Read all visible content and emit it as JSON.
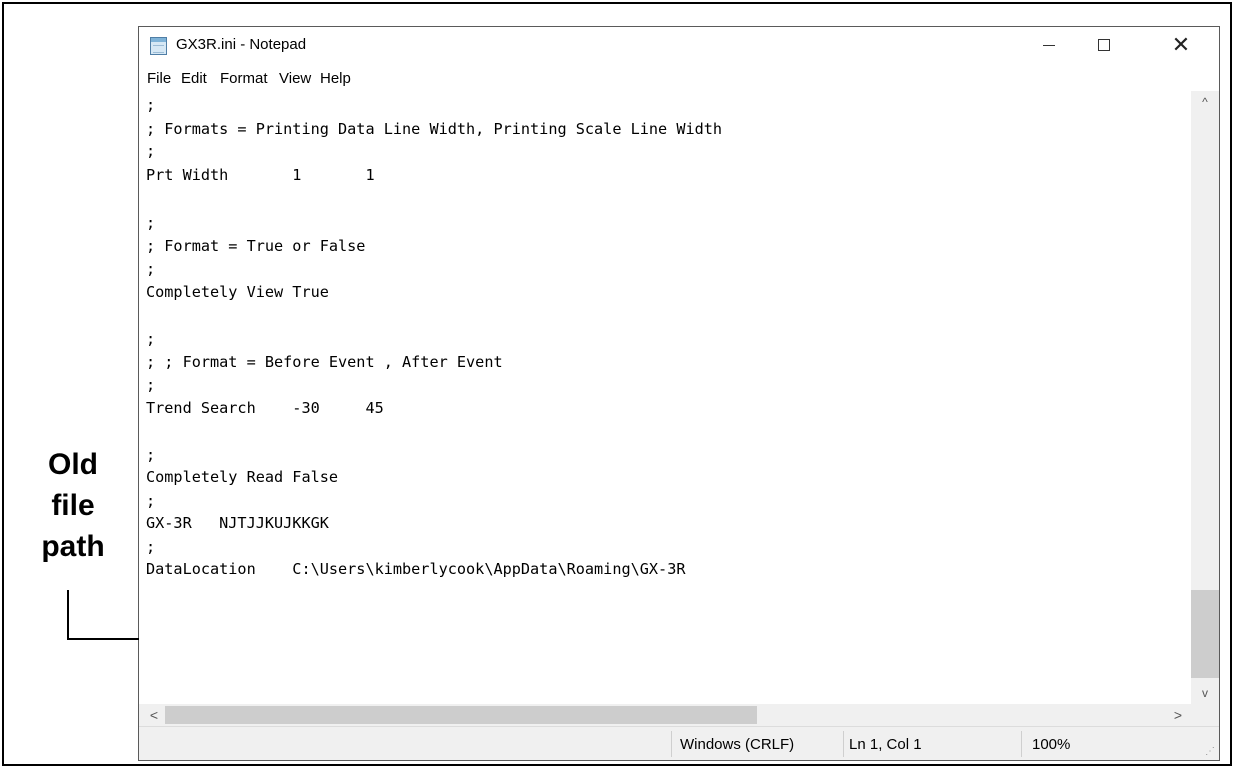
{
  "window": {
    "title": "GX3R.ini - Notepad",
    "minimize_glyph": "—",
    "maximize_glyph": "☐",
    "close_glyph": "✕"
  },
  "menu": {
    "items": [
      "File",
      "Edit",
      "Format",
      "View",
      "Help"
    ]
  },
  "editor": {
    "lines": [
      ";",
      "; Formats = Printing Data Line Width, Printing Scale Line Width",
      ";",
      "Prt Width       1       1",
      "",
      ";",
      "; Format = True or False",
      ";",
      "Completely View True",
      "",
      ";",
      "; ; Format = Before Event , After Event",
      ";",
      "Trend Search    -30     45",
      "",
      ";",
      "Completely Read False",
      ";",
      "GX-3R   NJTJJKUJKKGK",
      ";",
      "DataLocation    C:\\Users\\kimberlycook\\AppData\\Roaming\\GX-3R"
    ]
  },
  "scrollbars": {
    "up_arrow": "^",
    "down_arrow": "v",
    "left_arrow": "<",
    "right_arrow": ">"
  },
  "statusbar": {
    "line_ending": "Windows (CRLF)",
    "position": "Ln 1, Col 1",
    "zoom": "100%"
  },
  "annotation": {
    "line1": "Old",
    "line2": "file",
    "line3": "path"
  }
}
